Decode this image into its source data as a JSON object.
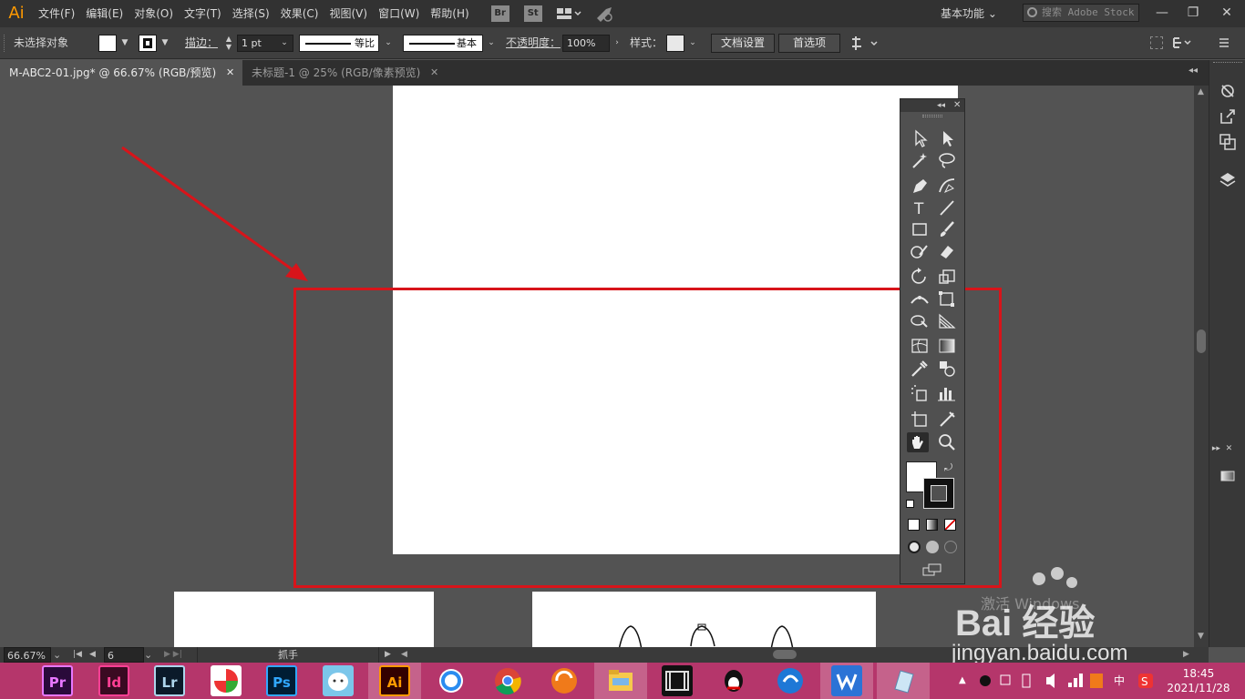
{
  "app": {
    "logo": "Ai"
  },
  "menu": [
    "文件(F)",
    "编辑(E)",
    "对象(O)",
    "文字(T)",
    "选择(S)",
    "效果(C)",
    "视图(V)",
    "窗口(W)",
    "帮助(H)"
  ],
  "bridge_labels": [
    "Br",
    "St"
  ],
  "workspace": "基本功能 ⌄",
  "search": {
    "placeholder": "搜索 Adobe Stock"
  },
  "window_controls": [
    "—",
    "❐",
    "✕"
  ],
  "control_bar": {
    "selection_label": "未选择对象",
    "stroke_label": "描边：",
    "stroke_weight": "1 pt",
    "profile_uniform": "等比",
    "brush_basic": "基本",
    "opacity_label": "不透明度：",
    "opacity_value": "100%",
    "style_label": "样式：",
    "doc_setup": "文档设置",
    "preferences": "首选项"
  },
  "tabs": [
    {
      "label": "M-ABC2-01.jpg* @ 66.67% (RGB/预览)",
      "close": "✕",
      "active": true
    },
    {
      "label": "未标题-1 @ 25% (RGB/像素预览)",
      "close": "✕",
      "active": false
    }
  ],
  "status": {
    "zoom": "66.67%",
    "artboard": "6",
    "tool": "抓手"
  },
  "watermark": {
    "activate": "激活 Windows",
    "brand": "Bai 经验",
    "url": "jingyan.baidu.com"
  },
  "taskbar": {
    "apps": [
      "Pr",
      "Id",
      "Lr",
      "",
      "Ps",
      "",
      "Ai",
      "",
      "",
      "",
      "",
      "",
      "",
      "",
      "",
      ""
    ],
    "tray_ime": "中",
    "time": "18:45",
    "date": "2021/11/28"
  },
  "colors": {
    "accent_red": "#d8141a",
    "ai_orange": "#ff9a00",
    "taskbar": "#b5366b"
  }
}
